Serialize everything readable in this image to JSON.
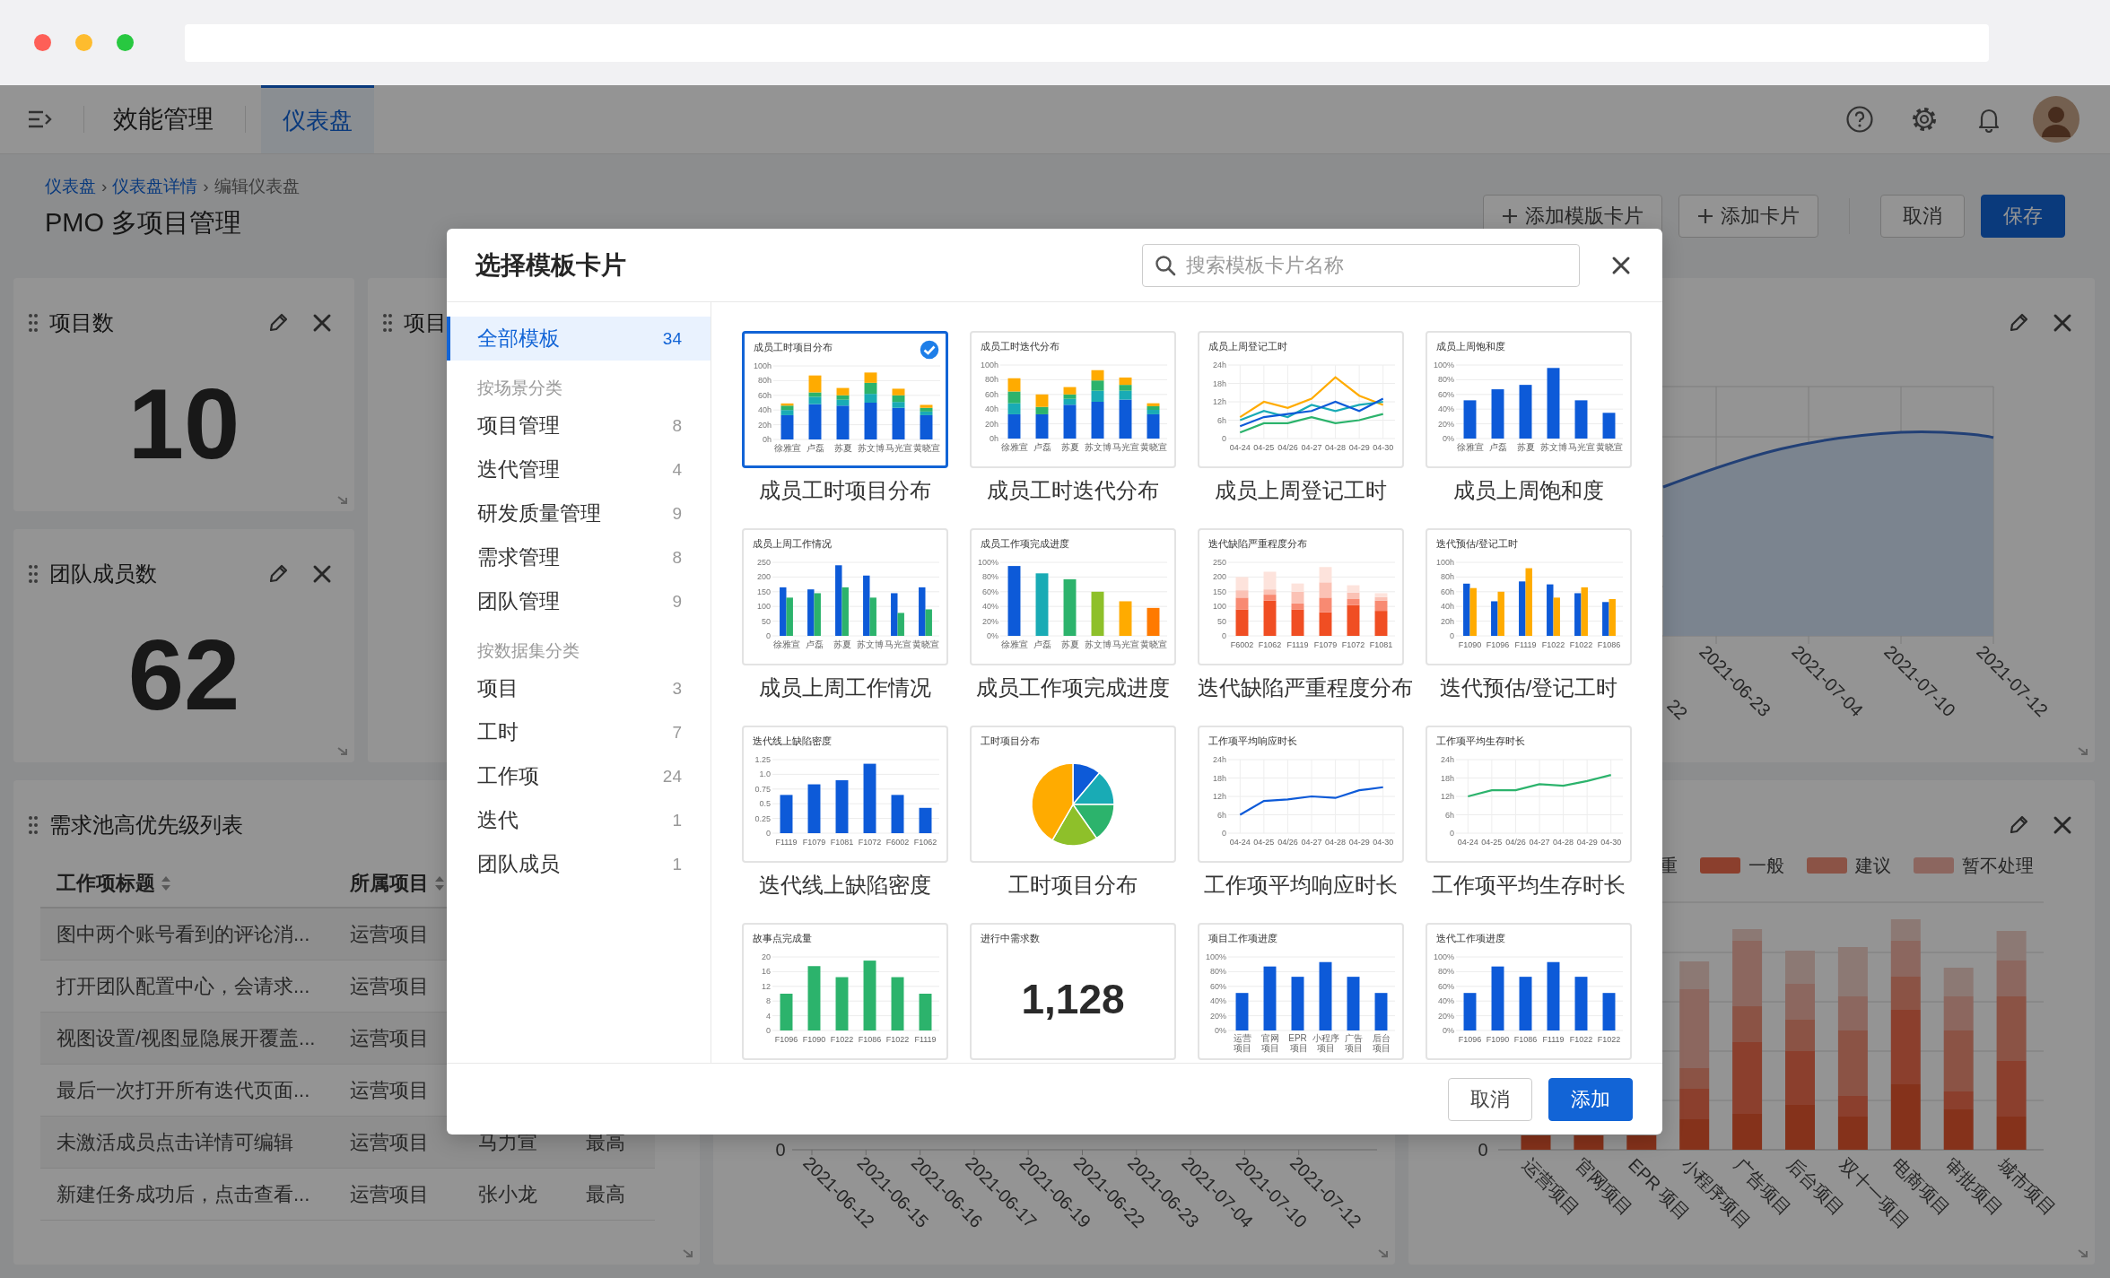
{
  "header": {
    "app_name": "效能管理",
    "tabs": [
      {
        "label": "仪表盘",
        "selected": true
      }
    ]
  },
  "toolbar": {
    "breadcrumb": {
      "separator": "›",
      "items": [
        {
          "label": "仪表盘",
          "link": true
        },
        {
          "label": "仪表盘详情",
          "link": true
        },
        {
          "label": "编辑仪表盘",
          "link": false
        }
      ]
    },
    "title": "PMO 多项目管理",
    "buttons": [
      {
        "label": "添加模版卡片",
        "kind": "add"
      },
      {
        "label": "添加卡片",
        "kind": "add"
      },
      {
        "label": "取消",
        "kind": "plain"
      },
      {
        "label": "保存",
        "kind": "primary"
      }
    ]
  },
  "dashboard": {
    "cards": [
      {
        "kind": "stat",
        "title": "项目数",
        "value": "10"
      },
      {
        "kind": "stub",
        "title": "项目"
      },
      {
        "kind": "area",
        "x_labels": [
          "22",
          "2021-06-23",
          "2021-07-04",
          "2021-07-10",
          "2021-07-12"
        ]
      },
      {
        "kind": "stat",
        "title": "团队成员数",
        "value": "62"
      },
      {
        "kind": "table",
        "title": "需求池高优先级列表",
        "columns": [
          "工作项标题",
          "所属项目"
        ],
        "rows": [
          [
            "图中两个账号看到的评论消...",
            "运营项目"
          ],
          [
            "打开团队配置中心，会请求...",
            "运营项目"
          ],
          [
            "视图设置/视图显隐展开覆盖...",
            "运营项目"
          ],
          [
            "最后一次打开所有迭代页面...",
            "运营项目"
          ],
          [
            "未激活成员点击详情可编辑",
            "运营项目",
            "马力宣",
            "最高"
          ],
          [
            "新建任务成功后，点击查看...",
            "运营项目",
            "张小龙",
            "最高"
          ]
        ]
      },
      {
        "kind": "axis",
        "y_label": "0",
        "x_labels": [
          "2021-06-12",
          "2021-06-15",
          "2021-06-16",
          "2021-06-17",
          "2021-06-19",
          "2021-06-22",
          "2021-06-23",
          "2021-07-04",
          "2021-07-10",
          "2021-07-12"
        ]
      },
      {
        "kind": "stacked",
        "legend": [
          {
            "label": "重"
          },
          {
            "label": "一般",
            "color": "#8b3f2d"
          },
          {
            "label": "建议",
            "color": "#8b5346"
          },
          {
            "label": "暂不处理",
            "color": "#8c665f"
          }
        ],
        "y_label": "0",
        "x_labels": [
          "运营项目",
          "官网项目",
          "EPR 项目",
          "小程序项目",
          "广告项目",
          "后台项目",
          "双十一项目",
          "电商项目",
          "审批项目",
          "城市项目"
        ]
      }
    ]
  },
  "dialog": {
    "title": "选择模板卡片",
    "search": {
      "placeholder": "搜索模板卡片名称"
    },
    "sidebar": [
      {
        "kind": "item",
        "label": "全部模板",
        "count": "34",
        "selected": true
      },
      {
        "kind": "group",
        "label": "按场景分类"
      },
      {
        "kind": "item",
        "label": "项目管理",
        "count": "8",
        "selected": false
      },
      {
        "kind": "item",
        "label": "迭代管理",
        "count": "4",
        "selected": false
      },
      {
        "kind": "item",
        "label": "研发质量管理",
        "count": "9",
        "selected": false
      },
      {
        "kind": "item",
        "label": "需求管理",
        "count": "8",
        "selected": false
      },
      {
        "kind": "item",
        "label": "团队管理",
        "count": "9",
        "selected": false
      },
      {
        "kind": "group",
        "label": "按数据集分类"
      },
      {
        "kind": "item",
        "label": "项目",
        "count": "3",
        "selected": false
      },
      {
        "kind": "item",
        "label": "工时",
        "count": "7",
        "selected": false
      },
      {
        "kind": "item",
        "label": "工作项",
        "count": "24",
        "selected": false
      },
      {
        "kind": "item",
        "label": "迭代",
        "count": "1",
        "selected": false
      },
      {
        "kind": "item",
        "label": "团队成员",
        "count": "1",
        "selected": false
      }
    ],
    "templates": [
      {
        "name": "成员工时项目分布",
        "selected": true,
        "thumb": {
          "title": "成员工时项目分布",
          "kind": "chart",
          "chart_data": {
            "type": "bar",
            "stacked": true,
            "grid": true,
            "categories": [
              "徐雅宣",
              "卢磊",
              "苏夏",
              "苏文博",
              "马光宣",
              "黄晓宣"
            ],
            "ylim": [
              0,
              100
            ],
            "yticks": [
              {
                "value": 0,
                "label": "0h"
              },
              {
                "value": 20,
                "label": "20h"
              },
              {
                "value": 40,
                "label": "40h"
              },
              {
                "value": 60,
                "label": "60h"
              },
              {
                "value": 80,
                "label": "80h"
              },
              {
                "value": 100,
                "label": "100h"
              }
            ],
            "series": [
              {
                "color": "#0d5ad8",
                "values": [
                  33,
                  48,
                  46,
                  50,
                  43,
                  33
                ]
              },
              {
                "color": "#19abb5",
                "values": [
                  7,
                  10,
                  8,
                  12,
                  8,
                  5
                ]
              },
              {
                "color": "#2cb36c",
                "values": [
                  6,
                  6,
                  6,
                  15,
                  9,
                  5
                ]
              },
              {
                "color": "#ffab00",
                "values": [
                  3,
                  23,
                  10,
                  14,
                  9,
                  4
                ]
              }
            ]
          }
        }
      },
      {
        "name": "成员工时迭代分布",
        "selected": false,
        "thumb": {
          "title": "成员工时迭代分布",
          "kind": "chart",
          "chart_data": {
            "type": "bar",
            "stacked": true,
            "grid": true,
            "categories": [
              "徐雅宣",
              "卢磊",
              "苏夏",
              "苏文博",
              "马光宣",
              "黄晓宣"
            ],
            "ylim": [
              0,
              100
            ],
            "yticks": [
              {
                "value": 0,
                "label": "0h"
              },
              {
                "value": 20,
                "label": "20h"
              },
              {
                "value": 40,
                "label": "40h"
              },
              {
                "value": 60,
                "label": "60h"
              },
              {
                "value": 80,
                "label": "80h"
              },
              {
                "value": 100,
                "label": "100h"
              }
            ],
            "series": [
              {
                "color": "#0d5ad8",
                "values": [
                  33,
                  33,
                  46,
                  50,
                  53,
                  33
                ]
              },
              {
                "color": "#19abb5",
                "values": [
                  15,
                  0,
                  8,
                  15,
                  12,
                  6
                ]
              },
              {
                "color": "#2cb36c",
                "values": [
                  16,
                  10,
                  6,
                  14,
                  8,
                  5
                ]
              },
              {
                "color": "#ffab00",
                "values": [
                  18,
                  17,
                  10,
                  14,
                  10,
                  4
                ]
              }
            ]
          }
        }
      },
      {
        "name": "成员上周登记工时",
        "selected": false,
        "thumb": {
          "title": "成员上周登记工时",
          "kind": "chart",
          "chart_data": {
            "type": "line",
            "grid": true,
            "categories": [
              "04-24",
              "04-25",
              "04/26",
              "04-27",
              "04-28",
              "04-29",
              "04-30"
            ],
            "ylim": [
              0,
              24
            ],
            "yticks": [
              {
                "value": 0,
                "label": "0"
              },
              {
                "value": 6,
                "label": "6h"
              },
              {
                "value": 12,
                "label": "12h"
              },
              {
                "value": 18,
                "label": "18h"
              },
              {
                "value": 24,
                "label": "24h"
              }
            ],
            "series": [
              {
                "color": "#ffab00",
                "values": [
                  7,
                  12,
                  10,
                  13,
                  20,
                  14,
                  11
                ]
              },
              {
                "color": "#19abb5",
                "values": [
                  6,
                  9,
                  7,
                  11,
                  9,
                  11,
                  12
                ]
              },
              {
                "color": "#0d5ad8",
                "values": [
                  4,
                  7,
                  8,
                  9,
                  12,
                  9,
                  13
                ]
              },
              {
                "color": "#2cb36c",
                "values": [
                  2,
                  5,
                  5,
                  7,
                  5,
                  6,
                  8
                ]
              }
            ]
          }
        }
      },
      {
        "name": "成员上周饱和度",
        "selected": false,
        "thumb": {
          "title": "成员上周饱和度",
          "kind": "chart",
          "chart_data": {
            "type": "bar",
            "grid": true,
            "categories": [
              "徐雅宣",
              "卢磊",
              "苏夏",
              "苏文博",
              "马光宣",
              "黄晓宣"
            ],
            "ylim": [
              0,
              100
            ],
            "yticks": [
              {
                "value": 0,
                "label": "0%"
              },
              {
                "value": 20,
                "label": "20%"
              },
              {
                "value": 40,
                "label": "40%"
              },
              {
                "value": 60,
                "label": "60%"
              },
              {
                "value": 80,
                "label": "80%"
              },
              {
                "value": 100,
                "label": "100%"
              }
            ],
            "series": [
              {
                "color": "#0d5ad8",
                "values": [
                  52,
                  67,
                  73,
                  96,
                  52,
                  35
                ]
              }
            ]
          }
        }
      },
      {
        "name": "成员上周工作情况",
        "selected": false,
        "thumb": {
          "title": "成员上周工作情况",
          "kind": "chart",
          "chart_data": {
            "type": "bar",
            "grid": true,
            "categories": [
              "徐雅宣",
              "卢磊",
              "苏夏",
              "苏文博",
              "马光宣",
              "黄晓宣"
            ],
            "ylim": [
              0,
              250
            ],
            "yticks": [
              {
                "value": 0,
                "label": "0"
              },
              {
                "value": 50,
                "label": "50"
              },
              {
                "value": 100,
                "label": "100"
              },
              {
                "value": 150,
                "label": "150"
              },
              {
                "value": 200,
                "label": "200"
              },
              {
                "value": 250,
                "label": "250"
              }
            ],
            "series": [
              {
                "color": "#0d5ad8",
                "values": [
                  165,
                  158,
                  240,
                  205,
                  145,
                  165
                ]
              },
              {
                "color": "#2cb36c",
                "values": [
                  130,
                  145,
                  165,
                  130,
                  78,
                  90
                ]
              }
            ]
          }
        }
      },
      {
        "name": "成员工作项完成进度",
        "selected": false,
        "thumb": {
          "title": "成员工作项完成进度",
          "kind": "chart",
          "chart_data": {
            "type": "bar",
            "stacked": true,
            "grid": true,
            "categories": [
              "徐雅宣",
              "卢磊",
              "苏夏",
              "苏文博",
              "马光宣",
              "黄晓宣"
            ],
            "ylim": [
              0,
              100
            ],
            "yticks": [
              {
                "value": 0,
                "label": "0%"
              },
              {
                "value": 20,
                "label": "20%"
              },
              {
                "value": 40,
                "label": "40%"
              },
              {
                "value": 60,
                "label": "60%"
              },
              {
                "value": 80,
                "label": "80%"
              },
              {
                "value": 100,
                "label": "100%"
              }
            ],
            "series": [
              {
                "color": "#0d5ad8",
                "values": [
                  95,
                  null,
                  null,
                  null,
                  null,
                  null
                ]
              },
              {
                "color": "#19abb5",
                "values": [
                  null,
                  85,
                  null,
                  null,
                  null,
                  null
                ]
              },
              {
                "color": "#2cb36c",
                "values": [
                  null,
                  null,
                  77,
                  null,
                  null,
                  null
                ]
              },
              {
                "color": "#8ec02a",
                "values": [
                  null,
                  null,
                  null,
                  60,
                  null,
                  null
                ]
              },
              {
                "color": "#ffab00",
                "values": [
                  null,
                  null,
                  null,
                  null,
                  47,
                  null
                ]
              },
              {
                "color": "#ff7a00",
                "values": [
                  null,
                  null,
                  null,
                  null,
                  null,
                  38
                ]
              }
            ]
          }
        }
      },
      {
        "name": "迭代缺陷严重程度分布",
        "selected": false,
        "thumb": {
          "title": "迭代缺陷严重程度分布",
          "kind": "chart",
          "chart_data": {
            "type": "bar",
            "stacked": true,
            "grid": true,
            "categories": [
              "F6002",
              "F1062",
              "F1119",
              "F1079",
              "F1072",
              "F1081"
            ],
            "ylim": [
              0,
              250
            ],
            "yticks": [
              {
                "value": 0,
                "label": "0"
              },
              {
                "value": 50,
                "label": "50"
              },
              {
                "value": 100,
                "label": "100"
              },
              {
                "value": 150,
                "label": "150"
              },
              {
                "value": 200,
                "label": "200"
              },
              {
                "value": 250,
                "label": "250"
              }
            ],
            "series": [
              {
                "color": "#f04e23",
                "values": [
                  90,
                  120,
                  90,
                  80,
                  105,
                  85
                ]
              },
              {
                "color": "#f88a72",
                "values": [
                  40,
                  20,
                  20,
                  50,
                  20,
                  35
                ]
              },
              {
                "color": "#fbc2b5",
                "values": [
                  25,
                  18,
                  40,
                  52,
                  22,
                  12
                ]
              },
              {
                "color": "#fde3dc",
                "values": [
                  45,
                  60,
                  28,
                  52,
                  25,
                  13
                ]
              }
            ]
          }
        }
      },
      {
        "name": "迭代预估/登记工时",
        "selected": false,
        "thumb": {
          "title": "迭代预估/登记工时",
          "kind": "chart",
          "chart_data": {
            "type": "bar",
            "grid": true,
            "categories": [
              "F1090",
              "F1096",
              "F1119",
              "F1022",
              "F1022",
              "F1086"
            ],
            "ylim": [
              0,
              100
            ],
            "yticks": [
              {
                "value": 0,
                "label": "0"
              },
              {
                "value": 20,
                "label": "20h"
              },
              {
                "value": 40,
                "label": "40h"
              },
              {
                "value": 60,
                "label": "60h"
              },
              {
                "value": 80,
                "label": "80h"
              },
              {
                "value": 100,
                "label": "100h"
              }
            ],
            "series": [
              {
                "color": "#0d5ad8",
                "values": [
                  71,
                  47,
                  74,
                  70,
                  58,
                  46
                ]
              },
              {
                "color": "#ffab00",
                "values": [
                  65,
                  60,
                  92,
                  52,
                  66,
                  50
                ]
              }
            ]
          }
        }
      },
      {
        "name": "迭代线上缺陷密度",
        "selected": false,
        "thumb": {
          "title": "迭代线上缺陷密度",
          "kind": "chart",
          "chart_data": {
            "type": "bar",
            "grid": true,
            "categories": [
              "F1119",
              "F1079",
              "F1081",
              "F1072",
              "F6002",
              "F1062"
            ],
            "ylim": [
              0,
              1.25
            ],
            "yticks": [
              {
                "value": 0,
                "label": "0"
              },
              {
                "value": 0.25,
                "label": "0.25"
              },
              {
                "value": 0.5,
                "label": "0.5"
              },
              {
                "value": 0.75,
                "label": "0.75"
              },
              {
                "value": 1,
                "label": "1.0"
              },
              {
                "value": 1.25,
                "label": "1.25"
              }
            ],
            "series": [
              {
                "color": "#0d5ad8",
                "values": [
                  0.65,
                  0.83,
                  0.9,
                  1.18,
                  0.65,
                  0.43
                ]
              }
            ]
          }
        }
      },
      {
        "name": "工时项目分布",
        "selected": false,
        "thumb": {
          "title": "工时项目分布",
          "kind": "pie"
        }
      },
      {
        "name": "工作项平均响应时长",
        "selected": false,
        "thumb": {
          "title": "工作项平均响应时长",
          "kind": "chart",
          "chart_data": {
            "type": "line",
            "grid": true,
            "categories": [
              "04-24",
              "04-25",
              "04/26",
              "04-27",
              "04-28",
              "04-29",
              "04-30"
            ],
            "ylim": [
              0,
              24
            ],
            "yticks": [
              {
                "value": 0,
                "label": "0"
              },
              {
                "value": 6,
                "label": "6h"
              },
              {
                "value": 12,
                "label": "12h"
              },
              {
                "value": 18,
                "label": "18h"
              },
              {
                "value": 24,
                "label": "24h"
              }
            ],
            "series": [
              {
                "color": "#0d5ad8",
                "values": [
                  6,
                  10.5,
                  11,
                  12,
                  11.5,
                  14,
                  15
                ]
              }
            ]
          }
        }
      },
      {
        "name": "工作项平均生存时长",
        "selected": false,
        "thumb": {
          "title": "工作项平均生存时长",
          "kind": "chart",
          "chart_data": {
            "type": "line",
            "grid": true,
            "categories": [
              "04-24",
              "04-25",
              "04/26",
              "04-27",
              "04-28",
              "04-29",
              "04-30"
            ],
            "ylim": [
              0,
              24
            ],
            "yticks": [
              {
                "value": 0,
                "label": "0"
              },
              {
                "value": 6,
                "label": "6h"
              },
              {
                "value": 12,
                "label": "12h"
              },
              {
                "value": 18,
                "label": "18h"
              },
              {
                "value": 24,
                "label": "24h"
              }
            ],
            "series": [
              {
                "color": "#2cb36c",
                "values": [
                  12,
                  14,
                  14,
                  16,
                  15.5,
                  17,
                  19
                ]
              }
            ]
          }
        }
      },
      {
        "selected": false,
        "thumb": {
          "title": "故事点完成量",
          "kind": "chart",
          "chart_data": {
            "type": "bar",
            "grid": true,
            "categories": [
              "F1096",
              "F1090",
              "F1022",
              "F1086",
              "F1022",
              "F1119"
            ],
            "ylim": [
              0,
              20
            ],
            "yticks": [
              {
                "value": 0,
                "label": "0"
              },
              {
                "value": 4,
                "label": "4"
              },
              {
                "value": 8,
                "label": "8"
              },
              {
                "value": 12,
                "label": "12"
              },
              {
                "value": 16,
                "label": "16"
              },
              {
                "value": 20,
                "label": "20"
              }
            ],
            "series": [
              {
                "color": "#2cb36c",
                "values": [
                  10,
                  17.5,
                  14.5,
                  19,
                  14.5,
                  10
                ]
              }
            ]
          }
        }
      },
      {
        "selected": false,
        "thumb": {
          "title": "进行中需求数",
          "kind": "number",
          "value": "1,128"
        }
      },
      {
        "selected": false,
        "thumb": {
          "title": "项目工作项进度",
          "kind": "chart",
          "chart_data": {
            "type": "bar",
            "grid": true,
            "categories": [
              "运营项目",
              "官网项目",
              "EPR 项目",
              "小程序项目",
              "广告项目",
              "后台项目"
            ],
            "ylim": [
              0,
              100
            ],
            "yticks": [
              {
                "value": 0,
                "label": "0%"
              },
              {
                "value": 20,
                "label": "20%"
              },
              {
                "value": 40,
                "label": "40%"
              },
              {
                "value": 60,
                "label": "60%"
              },
              {
                "value": 80,
                "label": "80%"
              },
              {
                "value": 100,
                "label": "100%"
              }
            ],
            "series": [
              {
                "color": "#0d5ad8",
                "values": [
                  51,
                  87,
                  73,
                  93,
                  73,
                  51
                ]
              }
            ]
          }
        }
      },
      {
        "selected": false,
        "thumb": {
          "title": "迭代工作项进度",
          "kind": "chart",
          "chart_data": {
            "type": "bar",
            "grid": true,
            "categories": [
              "F1096",
              "F1090",
              "F1086",
              "F1119",
              "F1022",
              "F1022"
            ],
            "ylim": [
              0,
              100
            ],
            "yticks": [
              {
                "value": 0,
                "label": "0%"
              },
              {
                "value": 20,
                "label": "20%"
              },
              {
                "value": 40,
                "label": "40%"
              },
              {
                "value": 60,
                "label": "60%"
              },
              {
                "value": 80,
                "label": "80%"
              },
              {
                "value": 100,
                "label": "100%"
              }
            ],
            "series": [
              {
                "color": "#0d5ad8",
                "values": [
                  51,
                  87,
                  73,
                  93,
                  73,
                  51
                ]
              }
            ]
          }
        }
      }
    ],
    "buttons": [
      {
        "label": "取消",
        "kind": "plain"
      },
      {
        "label": "添加",
        "kind": "primary"
      }
    ]
  }
}
